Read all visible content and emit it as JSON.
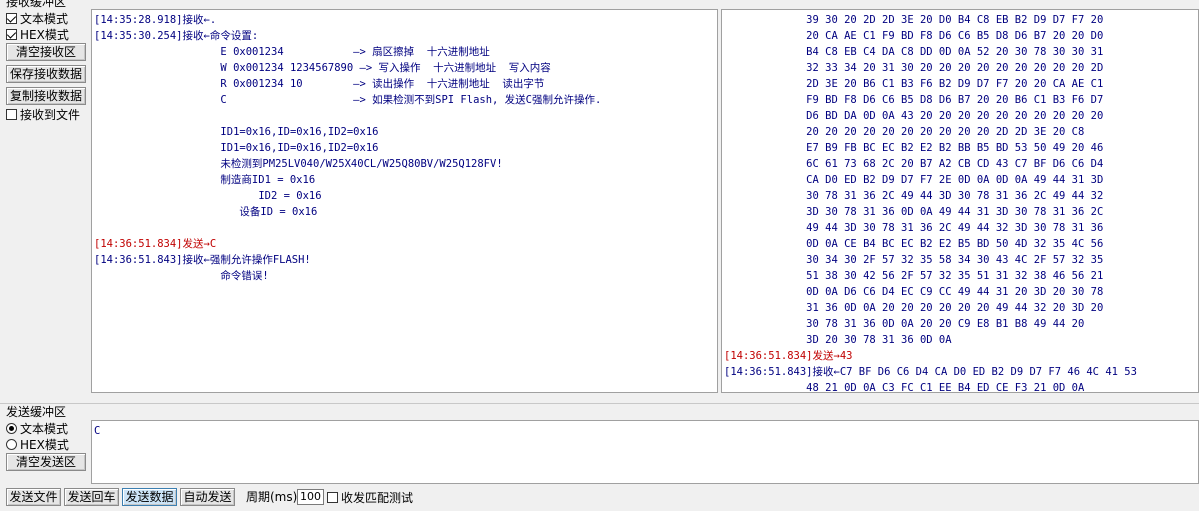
{
  "receive": {
    "group_title": "接收缓冲区",
    "text_mode": "文本模式",
    "hex_mode": "HEX模式",
    "clear_button": "清空接收区",
    "save_button": "保存接收数据",
    "copy_button": "复制接收数据",
    "to_file": "接收到文件",
    "text_log": [
      {
        "type": "recv",
        "text": "[14:35:28.918]接收←."
      },
      {
        "type": "recv",
        "text": "[14:35:30.254]接收←命令设置:"
      },
      {
        "type": "recv",
        "text": "                    E 0x001234           —> 扇区擦掉  十六进制地址"
      },
      {
        "type": "recv",
        "text": "                    W 0x001234 1234567890 —> 写入操作  十六进制地址  写入内容"
      },
      {
        "type": "recv",
        "text": "                    R 0x001234 10        —> 读出操作  十六进制地址  读出字节"
      },
      {
        "type": "recv",
        "text": "                    C                    —> 如果检测不到SPI Flash, 发送C强制允许操作."
      },
      {
        "type": "recv",
        "text": ""
      },
      {
        "type": "recv",
        "text": "                    ID1=0x16,ID=0x16,ID2=0x16"
      },
      {
        "type": "recv",
        "text": "                    ID1=0x16,ID=0x16,ID2=0x16"
      },
      {
        "type": "recv",
        "text": "                    未检测到PM25LV040/W25X40CL/W25Q80BV/W25Q128FV!"
      },
      {
        "type": "recv",
        "text": "                    制造商ID1 = 0x16"
      },
      {
        "type": "recv",
        "text": "                          ID2 = 0x16"
      },
      {
        "type": "recv",
        "text": "                       设备ID = 0x16"
      },
      {
        "type": "recv",
        "text": ""
      },
      {
        "type": "sent",
        "text": "[14:36:51.834]发送→C"
      },
      {
        "type": "recv",
        "text": "[14:36:51.843]接收←强制允许操作FLASH!"
      },
      {
        "type": "recv",
        "text": "                    命令错误!"
      }
    ],
    "hex_log": [
      {
        "type": "recv",
        "text": "             39 30 20 2D 2D 3E 20 D0 B4 C8 EB B2 D9 D7 F7 20"
      },
      {
        "type": "recv",
        "text": "             20 CA AE C1 F9 BD F8 D6 C6 B5 D8 D6 B7 20 20 D0"
      },
      {
        "type": "recv",
        "text": "             B4 C8 EB C4 DA C8 DD 0D 0A 52 20 30 78 30 30 31"
      },
      {
        "type": "recv",
        "text": "             32 33 34 20 31 30 20 20 20 20 20 20 20 20 20 2D"
      },
      {
        "type": "recv",
        "text": "             2D 3E 20 B6 C1 B3 F6 B2 D9 D7 F7 20 20 CA AE C1"
      },
      {
        "type": "recv",
        "text": "             F9 BD F8 D6 C6 B5 D8 D6 B7 20 20 B6 C1 B3 F6 D7"
      },
      {
        "type": "recv",
        "text": "             D6 BD DA 0D 0A 43 20 20 20 20 20 20 20 20 20 20"
      },
      {
        "type": "recv",
        "text": "             20 20 20 20 20 20 20 20 20 20 2D 2D 3E 20 C8"
      },
      {
        "type": "recv",
        "text": "             E7 B9 FB BC EC B2 E2 B2 BB B5 BD 53 50 49 20 46"
      },
      {
        "type": "recv",
        "text": "             6C 61 73 68 2C 20 B7 A2 CB CD 43 C7 BF D6 C6 D4"
      },
      {
        "type": "recv",
        "text": "             CA D0 ED B2 D9 D7 F7 2E 0D 0A 0D 0A 49 44 31 3D"
      },
      {
        "type": "recv",
        "text": "             30 78 31 36 2C 49 44 3D 30 78 31 36 2C 49 44 32"
      },
      {
        "type": "recv",
        "text": "             3D 30 78 31 36 0D 0A 49 44 31 3D 30 78 31 36 2C"
      },
      {
        "type": "recv",
        "text": "             49 44 3D 30 78 31 36 2C 49 44 32 3D 30 78 31 36"
      },
      {
        "type": "recv",
        "text": "             0D 0A CE B4 BC EC B2 E2 B5 BD 50 4D 32 35 4C 56"
      },
      {
        "type": "recv",
        "text": "             30 34 30 2F 57 32 35 58 34 30 43 4C 2F 57 32 35"
      },
      {
        "type": "recv",
        "text": "             51 38 30 42 56 2F 57 32 35 51 31 32 38 46 56 21"
      },
      {
        "type": "recv",
        "text": "             0D 0A D6 C6 D4 EC C9 CC 49 44 31 20 3D 20 30 78"
      },
      {
        "type": "recv",
        "text": "             31 36 0D 0A 20 20 20 20 20 20 49 44 32 20 3D 20"
      },
      {
        "type": "recv",
        "text": "             30 78 31 36 0D 0A 20 20 C9 E8 B1 B8 49 44 20"
      },
      {
        "type": "recv",
        "text": "             3D 20 30 78 31 36 0D 0A"
      },
      {
        "type": "sent",
        "text": "[14:36:51.834]发送→43"
      },
      {
        "type": "recv",
        "text": "[14:36:51.843]接收←C7 BF D6 C6 D4 CA D0 ED B2 D9 D7 F7 46 4C 41 53"
      },
      {
        "type": "recv",
        "text": "             48 21 0D 0A C3 FC C1 EE B4 ED CE F3 21 0D 0A"
      }
    ]
  },
  "send": {
    "group_title": "发送缓冲区",
    "text_mode": "文本模式",
    "hex_mode": "HEX模式",
    "clear_button": "清空发送区",
    "content": "C"
  },
  "bottom": {
    "send_file": "发送文件",
    "send_enter": "发送回车",
    "send_data": "发送数据",
    "auto_send": "自动发送",
    "period_label": "周期(ms)",
    "period_value": "100",
    "match_test": "收发匹配测试"
  }
}
